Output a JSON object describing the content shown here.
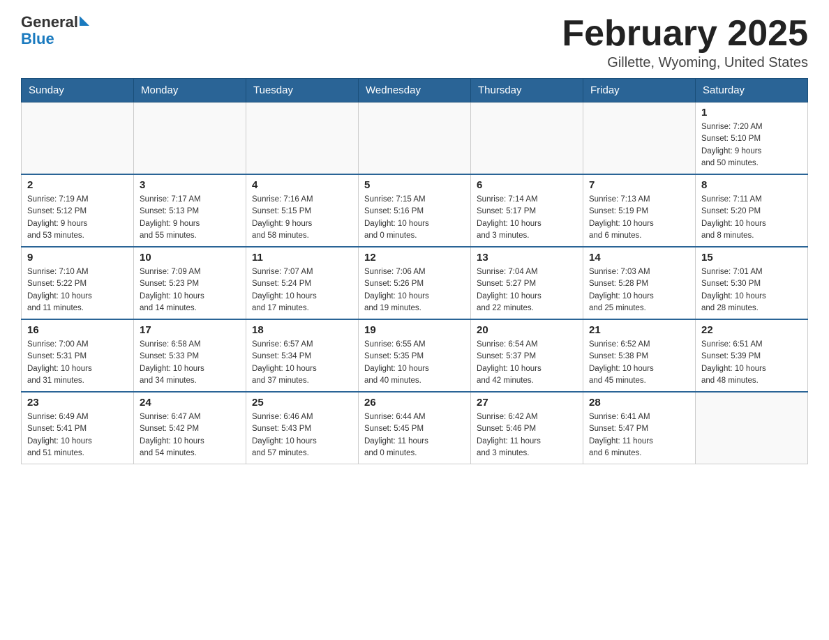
{
  "header": {
    "logo_general": "General",
    "logo_blue": "Blue",
    "month_title": "February 2025",
    "location": "Gillette, Wyoming, United States"
  },
  "weekdays": [
    "Sunday",
    "Monday",
    "Tuesday",
    "Wednesday",
    "Thursday",
    "Friday",
    "Saturday"
  ],
  "weeks": [
    [
      {
        "day": "",
        "info": ""
      },
      {
        "day": "",
        "info": ""
      },
      {
        "day": "",
        "info": ""
      },
      {
        "day": "",
        "info": ""
      },
      {
        "day": "",
        "info": ""
      },
      {
        "day": "",
        "info": ""
      },
      {
        "day": "1",
        "info": "Sunrise: 7:20 AM\nSunset: 5:10 PM\nDaylight: 9 hours\nand 50 minutes."
      }
    ],
    [
      {
        "day": "2",
        "info": "Sunrise: 7:19 AM\nSunset: 5:12 PM\nDaylight: 9 hours\nand 53 minutes."
      },
      {
        "day": "3",
        "info": "Sunrise: 7:17 AM\nSunset: 5:13 PM\nDaylight: 9 hours\nand 55 minutes."
      },
      {
        "day": "4",
        "info": "Sunrise: 7:16 AM\nSunset: 5:15 PM\nDaylight: 9 hours\nand 58 minutes."
      },
      {
        "day": "5",
        "info": "Sunrise: 7:15 AM\nSunset: 5:16 PM\nDaylight: 10 hours\nand 0 minutes."
      },
      {
        "day": "6",
        "info": "Sunrise: 7:14 AM\nSunset: 5:17 PM\nDaylight: 10 hours\nand 3 minutes."
      },
      {
        "day": "7",
        "info": "Sunrise: 7:13 AM\nSunset: 5:19 PM\nDaylight: 10 hours\nand 6 minutes."
      },
      {
        "day": "8",
        "info": "Sunrise: 7:11 AM\nSunset: 5:20 PM\nDaylight: 10 hours\nand 8 minutes."
      }
    ],
    [
      {
        "day": "9",
        "info": "Sunrise: 7:10 AM\nSunset: 5:22 PM\nDaylight: 10 hours\nand 11 minutes."
      },
      {
        "day": "10",
        "info": "Sunrise: 7:09 AM\nSunset: 5:23 PM\nDaylight: 10 hours\nand 14 minutes."
      },
      {
        "day": "11",
        "info": "Sunrise: 7:07 AM\nSunset: 5:24 PM\nDaylight: 10 hours\nand 17 minutes."
      },
      {
        "day": "12",
        "info": "Sunrise: 7:06 AM\nSunset: 5:26 PM\nDaylight: 10 hours\nand 19 minutes."
      },
      {
        "day": "13",
        "info": "Sunrise: 7:04 AM\nSunset: 5:27 PM\nDaylight: 10 hours\nand 22 minutes."
      },
      {
        "day": "14",
        "info": "Sunrise: 7:03 AM\nSunset: 5:28 PM\nDaylight: 10 hours\nand 25 minutes."
      },
      {
        "day": "15",
        "info": "Sunrise: 7:01 AM\nSunset: 5:30 PM\nDaylight: 10 hours\nand 28 minutes."
      }
    ],
    [
      {
        "day": "16",
        "info": "Sunrise: 7:00 AM\nSunset: 5:31 PM\nDaylight: 10 hours\nand 31 minutes."
      },
      {
        "day": "17",
        "info": "Sunrise: 6:58 AM\nSunset: 5:33 PM\nDaylight: 10 hours\nand 34 minutes."
      },
      {
        "day": "18",
        "info": "Sunrise: 6:57 AM\nSunset: 5:34 PM\nDaylight: 10 hours\nand 37 minutes."
      },
      {
        "day": "19",
        "info": "Sunrise: 6:55 AM\nSunset: 5:35 PM\nDaylight: 10 hours\nand 40 minutes."
      },
      {
        "day": "20",
        "info": "Sunrise: 6:54 AM\nSunset: 5:37 PM\nDaylight: 10 hours\nand 42 minutes."
      },
      {
        "day": "21",
        "info": "Sunrise: 6:52 AM\nSunset: 5:38 PM\nDaylight: 10 hours\nand 45 minutes."
      },
      {
        "day": "22",
        "info": "Sunrise: 6:51 AM\nSunset: 5:39 PM\nDaylight: 10 hours\nand 48 minutes."
      }
    ],
    [
      {
        "day": "23",
        "info": "Sunrise: 6:49 AM\nSunset: 5:41 PM\nDaylight: 10 hours\nand 51 minutes."
      },
      {
        "day": "24",
        "info": "Sunrise: 6:47 AM\nSunset: 5:42 PM\nDaylight: 10 hours\nand 54 minutes."
      },
      {
        "day": "25",
        "info": "Sunrise: 6:46 AM\nSunset: 5:43 PM\nDaylight: 10 hours\nand 57 minutes."
      },
      {
        "day": "26",
        "info": "Sunrise: 6:44 AM\nSunset: 5:45 PM\nDaylight: 11 hours\nand 0 minutes."
      },
      {
        "day": "27",
        "info": "Sunrise: 6:42 AM\nSunset: 5:46 PM\nDaylight: 11 hours\nand 3 minutes."
      },
      {
        "day": "28",
        "info": "Sunrise: 6:41 AM\nSunset: 5:47 PM\nDaylight: 11 hours\nand 6 minutes."
      },
      {
        "day": "",
        "info": ""
      }
    ]
  ]
}
